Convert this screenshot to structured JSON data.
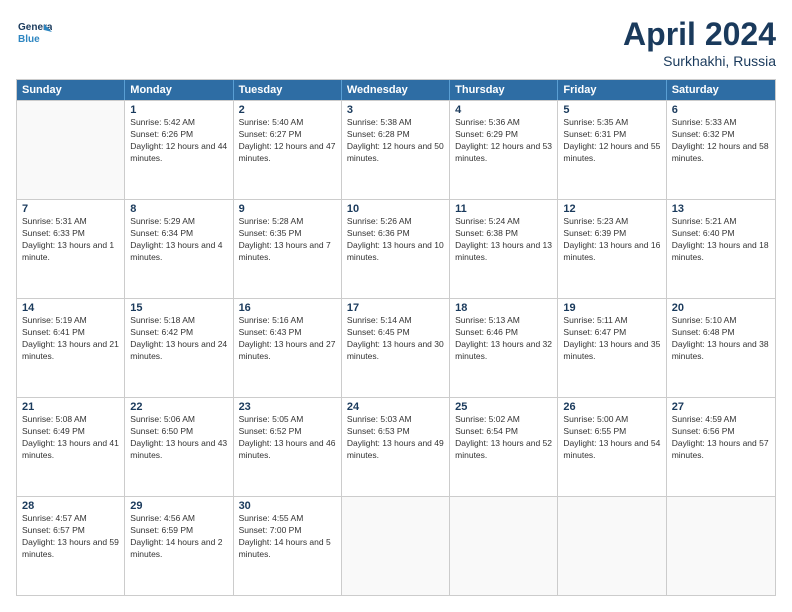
{
  "header": {
    "logo_general": "General",
    "logo_blue": "Blue",
    "title": "April 2024",
    "location": "Surkhakhi, Russia"
  },
  "calendar": {
    "days_of_week": [
      "Sunday",
      "Monday",
      "Tuesday",
      "Wednesday",
      "Thursday",
      "Friday",
      "Saturday"
    ],
    "weeks": [
      [
        {
          "day": "",
          "empty": true
        },
        {
          "day": "1",
          "sunrise": "Sunrise: 5:42 AM",
          "sunset": "Sunset: 6:26 PM",
          "daylight": "Daylight: 12 hours and 44 minutes."
        },
        {
          "day": "2",
          "sunrise": "Sunrise: 5:40 AM",
          "sunset": "Sunset: 6:27 PM",
          "daylight": "Daylight: 12 hours and 47 minutes."
        },
        {
          "day": "3",
          "sunrise": "Sunrise: 5:38 AM",
          "sunset": "Sunset: 6:28 PM",
          "daylight": "Daylight: 12 hours and 50 minutes."
        },
        {
          "day": "4",
          "sunrise": "Sunrise: 5:36 AM",
          "sunset": "Sunset: 6:29 PM",
          "daylight": "Daylight: 12 hours and 53 minutes."
        },
        {
          "day": "5",
          "sunrise": "Sunrise: 5:35 AM",
          "sunset": "Sunset: 6:31 PM",
          "daylight": "Daylight: 12 hours and 55 minutes."
        },
        {
          "day": "6",
          "sunrise": "Sunrise: 5:33 AM",
          "sunset": "Sunset: 6:32 PM",
          "daylight": "Daylight: 12 hours and 58 minutes."
        }
      ],
      [
        {
          "day": "7",
          "sunrise": "Sunrise: 5:31 AM",
          "sunset": "Sunset: 6:33 PM",
          "daylight": "Daylight: 13 hours and 1 minute."
        },
        {
          "day": "8",
          "sunrise": "Sunrise: 5:29 AM",
          "sunset": "Sunset: 6:34 PM",
          "daylight": "Daylight: 13 hours and 4 minutes."
        },
        {
          "day": "9",
          "sunrise": "Sunrise: 5:28 AM",
          "sunset": "Sunset: 6:35 PM",
          "daylight": "Daylight: 13 hours and 7 minutes."
        },
        {
          "day": "10",
          "sunrise": "Sunrise: 5:26 AM",
          "sunset": "Sunset: 6:36 PM",
          "daylight": "Daylight: 13 hours and 10 minutes."
        },
        {
          "day": "11",
          "sunrise": "Sunrise: 5:24 AM",
          "sunset": "Sunset: 6:38 PM",
          "daylight": "Daylight: 13 hours and 13 minutes."
        },
        {
          "day": "12",
          "sunrise": "Sunrise: 5:23 AM",
          "sunset": "Sunset: 6:39 PM",
          "daylight": "Daylight: 13 hours and 16 minutes."
        },
        {
          "day": "13",
          "sunrise": "Sunrise: 5:21 AM",
          "sunset": "Sunset: 6:40 PM",
          "daylight": "Daylight: 13 hours and 18 minutes."
        }
      ],
      [
        {
          "day": "14",
          "sunrise": "Sunrise: 5:19 AM",
          "sunset": "Sunset: 6:41 PM",
          "daylight": "Daylight: 13 hours and 21 minutes."
        },
        {
          "day": "15",
          "sunrise": "Sunrise: 5:18 AM",
          "sunset": "Sunset: 6:42 PM",
          "daylight": "Daylight: 13 hours and 24 minutes."
        },
        {
          "day": "16",
          "sunrise": "Sunrise: 5:16 AM",
          "sunset": "Sunset: 6:43 PM",
          "daylight": "Daylight: 13 hours and 27 minutes."
        },
        {
          "day": "17",
          "sunrise": "Sunrise: 5:14 AM",
          "sunset": "Sunset: 6:45 PM",
          "daylight": "Daylight: 13 hours and 30 minutes."
        },
        {
          "day": "18",
          "sunrise": "Sunrise: 5:13 AM",
          "sunset": "Sunset: 6:46 PM",
          "daylight": "Daylight: 13 hours and 32 minutes."
        },
        {
          "day": "19",
          "sunrise": "Sunrise: 5:11 AM",
          "sunset": "Sunset: 6:47 PM",
          "daylight": "Daylight: 13 hours and 35 minutes."
        },
        {
          "day": "20",
          "sunrise": "Sunrise: 5:10 AM",
          "sunset": "Sunset: 6:48 PM",
          "daylight": "Daylight: 13 hours and 38 minutes."
        }
      ],
      [
        {
          "day": "21",
          "sunrise": "Sunrise: 5:08 AM",
          "sunset": "Sunset: 6:49 PM",
          "daylight": "Daylight: 13 hours and 41 minutes."
        },
        {
          "day": "22",
          "sunrise": "Sunrise: 5:06 AM",
          "sunset": "Sunset: 6:50 PM",
          "daylight": "Daylight: 13 hours and 43 minutes."
        },
        {
          "day": "23",
          "sunrise": "Sunrise: 5:05 AM",
          "sunset": "Sunset: 6:52 PM",
          "daylight": "Daylight: 13 hours and 46 minutes."
        },
        {
          "day": "24",
          "sunrise": "Sunrise: 5:03 AM",
          "sunset": "Sunset: 6:53 PM",
          "daylight": "Daylight: 13 hours and 49 minutes."
        },
        {
          "day": "25",
          "sunrise": "Sunrise: 5:02 AM",
          "sunset": "Sunset: 6:54 PM",
          "daylight": "Daylight: 13 hours and 52 minutes."
        },
        {
          "day": "26",
          "sunrise": "Sunrise: 5:00 AM",
          "sunset": "Sunset: 6:55 PM",
          "daylight": "Daylight: 13 hours and 54 minutes."
        },
        {
          "day": "27",
          "sunrise": "Sunrise: 4:59 AM",
          "sunset": "Sunset: 6:56 PM",
          "daylight": "Daylight: 13 hours and 57 minutes."
        }
      ],
      [
        {
          "day": "28",
          "sunrise": "Sunrise: 4:57 AM",
          "sunset": "Sunset: 6:57 PM",
          "daylight": "Daylight: 13 hours and 59 minutes."
        },
        {
          "day": "29",
          "sunrise": "Sunrise: 4:56 AM",
          "sunset": "Sunset: 6:59 PM",
          "daylight": "Daylight: 14 hours and 2 minutes."
        },
        {
          "day": "30",
          "sunrise": "Sunrise: 4:55 AM",
          "sunset": "Sunset: 7:00 PM",
          "daylight": "Daylight: 14 hours and 5 minutes."
        },
        {
          "day": "",
          "empty": true
        },
        {
          "day": "",
          "empty": true
        },
        {
          "day": "",
          "empty": true
        },
        {
          "day": "",
          "empty": true
        }
      ]
    ]
  }
}
